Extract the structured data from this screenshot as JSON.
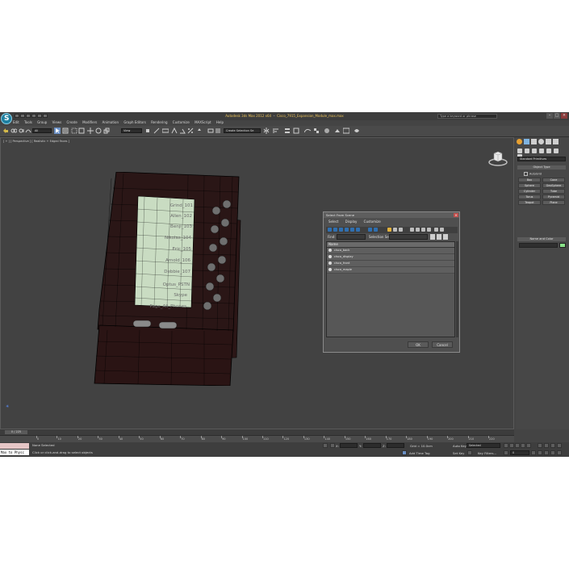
{
  "titlebar": {
    "app_title": "Autodesk 3ds Max 2012 x64",
    "file_name": "Cisco_7915_Expansion_Module_max.max",
    "search_placeholder": "Type a keyword or phrase",
    "window_buttons": [
      "–",
      "□",
      "×"
    ]
  },
  "menu": [
    "Edit",
    "Tools",
    "Group",
    "Views",
    "Create",
    "Modifiers",
    "Animation",
    "Graph Editors",
    "Rendering",
    "Customize",
    "MAXScript",
    "Help"
  ],
  "toolbar": {
    "selection_filter": "All",
    "reference_coord": "View",
    "named_selection": "Create Selection Se"
  },
  "viewport": {
    "label": "[ + ] [ Perspective ] [ Realistic + Edged Faces ]"
  },
  "phone": {
    "screen_labels": [
      "Grind_101",
      "Allen_102",
      "Benji_103",
      "Nikolas_104",
      "Eric_105",
      "Arnold_106",
      "Debbie_107",
      "Optus_PSTN",
      "Skype",
      "Page_All_Phones"
    ]
  },
  "dialog": {
    "title": "Select From Scene",
    "menu": [
      "Select",
      "Display",
      "Customize"
    ],
    "find_label": "Find:",
    "find_value": "",
    "selection_set_label": "Selection Set:",
    "selection_set_value": "",
    "column_header": "Name",
    "rows": [
      "cisco_back",
      "cisco_display",
      "cisco_front",
      "cisco_maple"
    ],
    "ok_label": "OK",
    "cancel_label": "Cancel",
    "close_glyph": "×"
  },
  "cmdpanel": {
    "primitive_type": "Standard Primitives",
    "object_type_title": "Object Type",
    "autogrid_label": "AutoGrid",
    "object_buttons": [
      "Box",
      "Cone",
      "Sphere",
      "GeoSphere",
      "Cylinder",
      "Tube",
      "Torus",
      "Pyramid",
      "Teapot",
      "Plane"
    ],
    "name_color_title": "Name and Color",
    "object_color": "#88e088"
  },
  "timeline": {
    "slider_label": "0 / 225",
    "ticks": [
      "0",
      "10",
      "20",
      "30",
      "40",
      "50",
      "60",
      "70",
      "80",
      "90",
      "100",
      "110",
      "120",
      "130",
      "140",
      "150",
      "160",
      "170",
      "180",
      "190",
      "200",
      "210",
      "220"
    ]
  },
  "status": {
    "maxscript_input": "Max to Physc",
    "selection_status": "None Selected",
    "prompt": "Click or click-and-drag to select objects",
    "x_label": "X:",
    "y_label": "Y:",
    "z_label": "Z:",
    "grid": "Grid = 10.0cm",
    "add_time_tag": "Add Time Tag",
    "auto_key": "Auto Key",
    "set_key": "Set Key",
    "selected": "Selected",
    "key_filters": "Key Filters...",
    "frame": "0"
  },
  "colors": {
    "maxscript_listener": "#e6c6c6",
    "phone_screen": "#c9dcc2",
    "wireframe": "#000000"
  }
}
